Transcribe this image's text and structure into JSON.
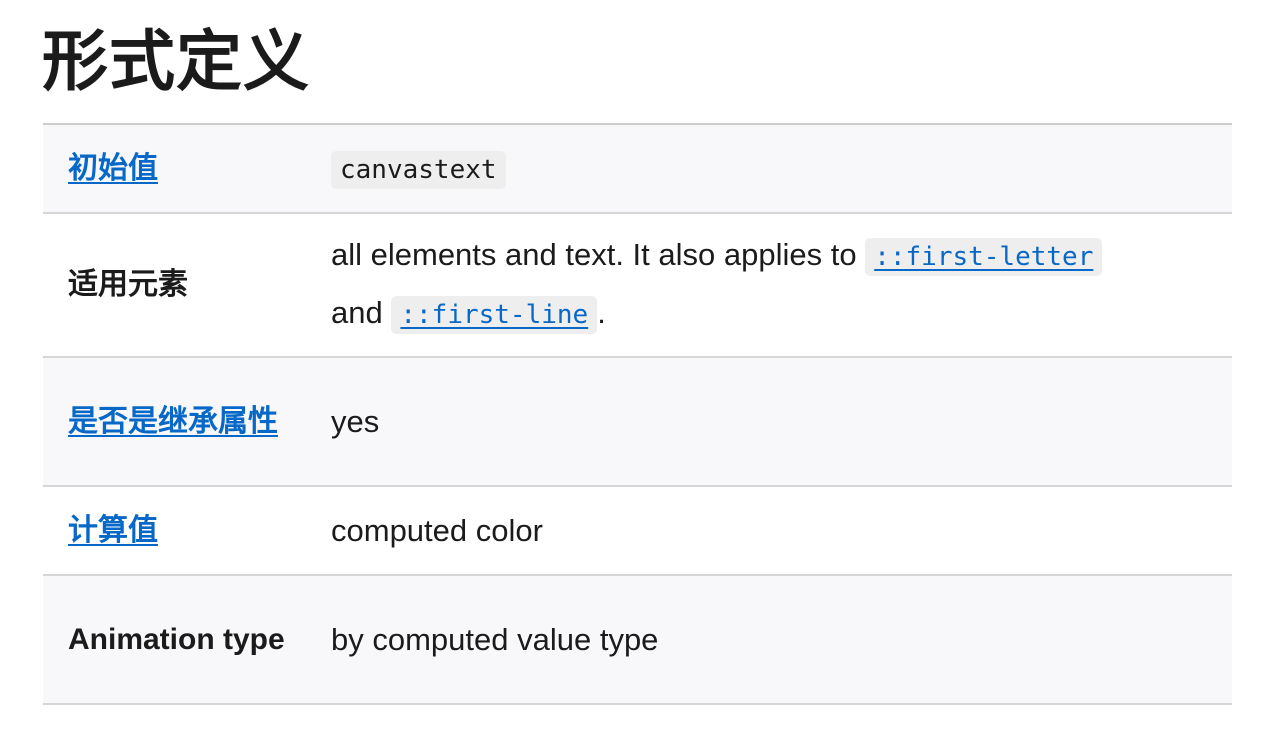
{
  "title": "形式定义",
  "rows": [
    {
      "label": "初始值",
      "value": "canvastext"
    },
    {
      "label": "适用元素",
      "text_before": "all elements and text. It also applies to",
      "code_link_1": "::first-letter",
      "text_middle": "and",
      "code_link_2": "::first-line",
      "text_after": "."
    },
    {
      "label": "是否是继承属性",
      "value": "yes"
    },
    {
      "label": "计算值",
      "value": "computed color"
    },
    {
      "label": "Animation type",
      "value": "by computed value type"
    }
  ],
  "colors": {
    "link": "#0868c7",
    "shaded_row": "#f8f8fa",
    "border": "#d6d6d6",
    "code_bg": "#eeeeee",
    "text": "#1b1b1b"
  }
}
